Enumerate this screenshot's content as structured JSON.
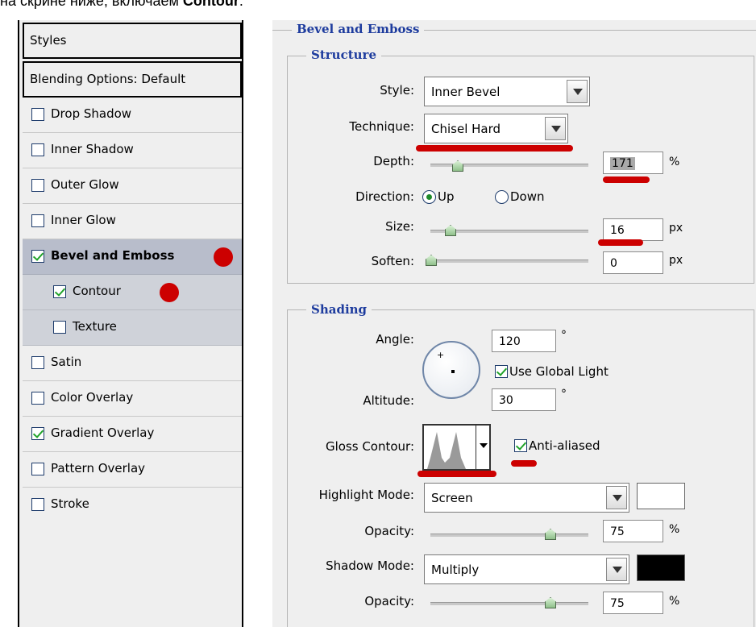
{
  "caption": {
    "prefix": "на скрине ниже, включаем ",
    "bold": "Contour",
    "suffix": "."
  },
  "styles_list": {
    "header": "Styles",
    "blending": "Blending Options: Default",
    "items": [
      {
        "label": "Drop Shadow",
        "checked": false
      },
      {
        "label": "Inner Shadow",
        "checked": false
      },
      {
        "label": "Outer Glow",
        "checked": false
      },
      {
        "label": "Inner Glow",
        "checked": false
      },
      {
        "label": "Bevel and Emboss",
        "checked": true
      },
      {
        "label": "Contour",
        "checked": true
      },
      {
        "label": "Texture",
        "checked": false
      },
      {
        "label": "Satin",
        "checked": false
      },
      {
        "label": "Color Overlay",
        "checked": false
      },
      {
        "label": "Gradient Overlay",
        "checked": true
      },
      {
        "label": "Pattern Overlay",
        "checked": false
      },
      {
        "label": "Stroke",
        "checked": false
      }
    ]
  },
  "bevel": {
    "title": "Bevel and Emboss",
    "structure": {
      "title": "Structure",
      "style_label": "Style:",
      "style_value": "Inner Bevel",
      "technique_label": "Technique:",
      "technique_value": "Chisel Hard",
      "depth_label": "Depth:",
      "depth_value": "171",
      "depth_unit": "%",
      "direction_label": "Direction:",
      "up_label": "Up",
      "down_label": "Down",
      "size_label": "Size:",
      "size_value": "16",
      "size_unit": "px",
      "soften_label": "Soften:",
      "soften_value": "0",
      "soften_unit": "px"
    },
    "shading": {
      "title": "Shading",
      "angle_label": "Angle:",
      "angle_value": "120",
      "degree": "°",
      "global_light_label": "Use Global Light",
      "global_light_checked": true,
      "altitude_label": "Altitude:",
      "altitude_value": "30",
      "gloss_label": "Gloss Contour:",
      "anti_aliased_label": "Anti-aliased",
      "anti_aliased_checked": true,
      "highlight_label": "Highlight Mode:",
      "highlight_value": "Screen",
      "highlight_color": "#ffffff",
      "hl_opacity_label": "Opacity:",
      "hl_opacity_value": "75",
      "hl_opacity_unit": "%",
      "shadow_label": "Shadow Mode:",
      "shadow_value": "Multiply",
      "shadow_color": "#000000",
      "sh_opacity_label": "Opacity:",
      "sh_opacity_value": "75",
      "sh_opacity_unit": "%"
    }
  },
  "colors": {
    "group_title": "#1e3c9e",
    "annotation": "#cc0000"
  }
}
